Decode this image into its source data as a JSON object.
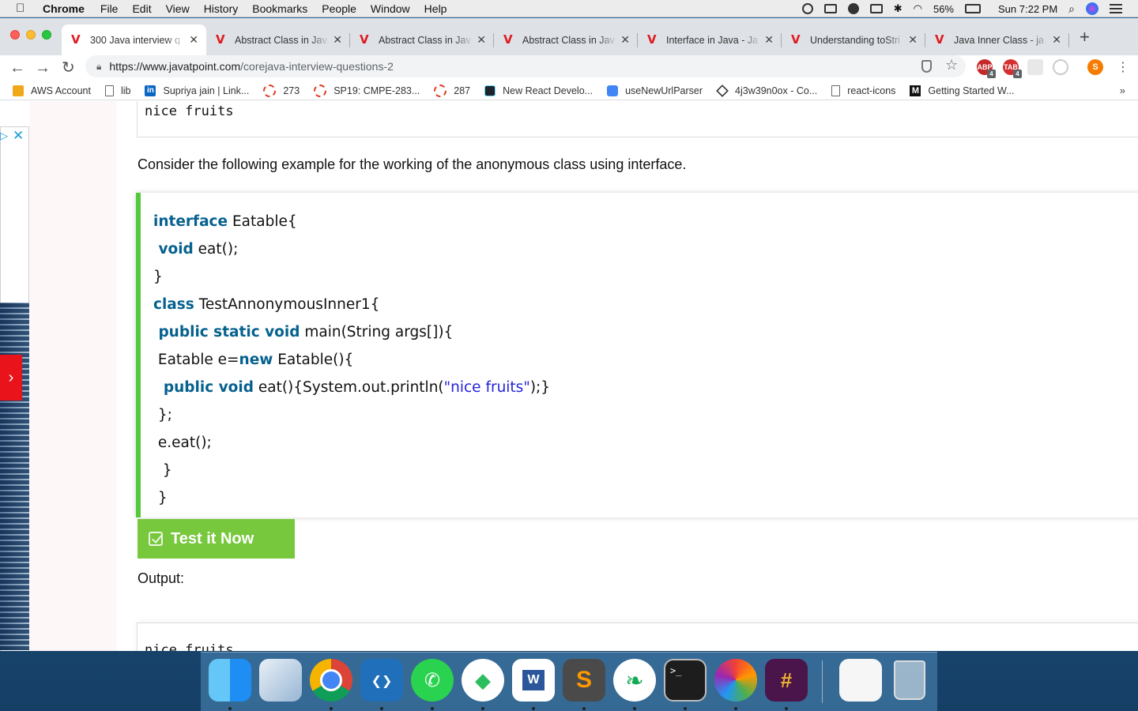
{
  "menubar": {
    "app_name": "Chrome",
    "menus": [
      "File",
      "Edit",
      "View",
      "History",
      "Bookmarks",
      "People",
      "Window",
      "Help"
    ],
    "battery": "56%",
    "clock": "Sun 7:22 PM"
  },
  "tabs": [
    {
      "title": "300 Java interview q",
      "active": true
    },
    {
      "title": "Abstract Class in Jav",
      "active": false
    },
    {
      "title": "Abstract Class in Jav",
      "active": false
    },
    {
      "title": "Abstract Class in Jav",
      "active": false
    },
    {
      "title": "Interface in Java - Ja",
      "active": false
    },
    {
      "title": "Understanding toStri",
      "active": false
    },
    {
      "title": "Java Inner Class - ja",
      "active": false
    }
  ],
  "omnibox": {
    "host": "https://www.javatpoint.com",
    "path": "/corejava-interview-questions-2"
  },
  "extensions": {
    "profile_initial": "S",
    "ext1_badge": "4",
    "ext2_badge": "4"
  },
  "bookmarks": [
    {
      "label": "AWS Account",
      "icon": "aws-icon"
    },
    {
      "label": "lib",
      "icon": "page-icon"
    },
    {
      "label": "Supriya jain | Link...",
      "icon": "linkedin-icon"
    },
    {
      "label": "273",
      "icon": "dashed-ring-icon"
    },
    {
      "label": "SP19: CMPE-283...",
      "icon": "dashed-ring-icon"
    },
    {
      "label": "287",
      "icon": "dashed-ring-icon"
    },
    {
      "label": "New React Develo...",
      "icon": "react-icon"
    },
    {
      "label": "useNewUrlParser",
      "icon": "google-doc-icon"
    },
    {
      "label": "4j3w39n0ox - Co...",
      "icon": "cube-icon"
    },
    {
      "label": "react-icons",
      "icon": "page-icon"
    },
    {
      "label": "Getting Started W...",
      "icon": "medium-icon"
    }
  ],
  "content": {
    "output_top": "nice fruits",
    "intro": "Consider the following example for the working of the anonymous class using interface.",
    "test_button": "Test it Now",
    "output_label": "Output:",
    "output_bottom": "nice fruits"
  },
  "code": [
    [
      {
        "t": "interface",
        "k": "kw"
      },
      {
        "t": " Eatable{",
        "k": ""
      }
    ],
    [
      {
        "t": " void",
        "k": "kw"
      },
      {
        "t": " eat();",
        "k": ""
      }
    ],
    [
      {
        "t": "}",
        "k": ""
      }
    ],
    [
      {
        "t": "class",
        "k": "kw"
      },
      {
        "t": " TestAnnonymousInner1{",
        "k": ""
      }
    ],
    [
      {
        "t": " public static void",
        "k": "kw"
      },
      {
        "t": " main(String args[]){",
        "k": ""
      }
    ],
    [
      {
        "t": " Eatable e=",
        "k": ""
      },
      {
        "t": "new",
        "k": "kw"
      },
      {
        "t": " Eatable(){",
        "k": ""
      }
    ],
    [
      {
        "t": "  public void",
        "k": "kw"
      },
      {
        "t": " eat(){System.out.println(",
        "k": ""
      },
      {
        "t": "\"nice fruits\"",
        "k": "str"
      },
      {
        "t": ");}",
        "k": ""
      }
    ],
    [
      {
        "t": " };",
        "k": ""
      }
    ],
    [
      {
        "t": " e.eat();",
        "k": ""
      }
    ],
    [
      {
        "t": "  }",
        "k": ""
      }
    ],
    [
      {
        "t": " }",
        "k": ""
      }
    ]
  ],
  "dock_apps": [
    "finder",
    "preview",
    "chrome",
    "visual-studio-code",
    "whatsapp",
    "evernote",
    "word",
    "sublime-text",
    "mongodb-compass",
    "terminal",
    "ios-app-installer",
    "slack",
    "documents-stack",
    "trash"
  ],
  "colors": {
    "keyword": "#06618f",
    "string": "#2222dd",
    "code_border": "#54c93a",
    "test_button": "#77c83c",
    "favicon": "#e0191f"
  }
}
